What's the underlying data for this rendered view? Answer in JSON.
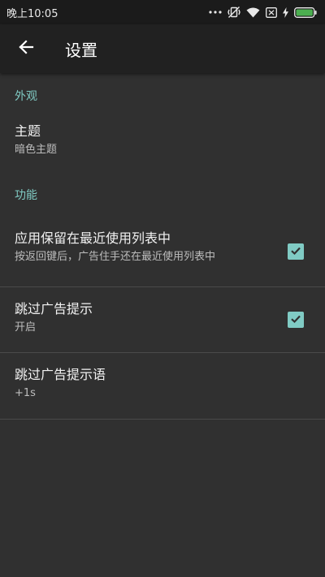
{
  "status_bar": {
    "time": "晚上10:05",
    "icons": [
      "more-dots-icon",
      "vibrate-off-icon",
      "wifi-icon",
      "sim-none-icon",
      "charging-icon",
      "battery-icon"
    ]
  },
  "app_bar": {
    "title": "设置",
    "back_icon": "arrow-back-icon"
  },
  "colors": {
    "accent": "#80cbc4",
    "background": "#303030",
    "app_bar": "#212121",
    "status_bar": "#1b1b1b",
    "battery": "#4caf50"
  },
  "sections": {
    "appearance": {
      "header": "外观",
      "theme": {
        "title": "主题",
        "summary": "暗色主题"
      }
    },
    "features": {
      "header": "功能",
      "keep_in_recents": {
        "title": "应用保留在最近使用列表中",
        "summary": "按返回键后，广告住手还在最近使用列表中",
        "checked": true
      },
      "skip_ad_hint": {
        "title": "跳过广告提示",
        "summary": "开启",
        "checked": true
      },
      "skip_ad_hint_text": {
        "title": "跳过广告提示语",
        "summary": "+1s"
      }
    }
  }
}
